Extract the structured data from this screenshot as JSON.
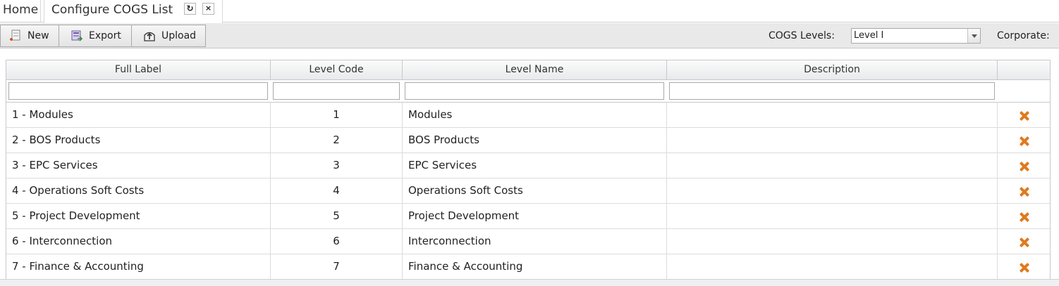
{
  "tabs": {
    "home": "Home",
    "active": "Configure COGS List",
    "refresh_glyph": "↻",
    "close_glyph": "×"
  },
  "toolbar": {
    "new_label": "New",
    "export_label": "Export",
    "upload_label": "Upload",
    "cogs_levels_label": "COGS Levels:",
    "cogs_levels_value": "Level I",
    "corporate_label": "Corporate:"
  },
  "grid": {
    "columns": [
      "Full Label",
      "Level Code",
      "Level Name",
      "Description"
    ],
    "rows": [
      {
        "full_label": "1 - Modules",
        "level_code": "1",
        "level_name": "Modules",
        "description": ""
      },
      {
        "full_label": "2 - BOS Products",
        "level_code": "2",
        "level_name": "BOS Products",
        "description": ""
      },
      {
        "full_label": "3 - EPC Services",
        "level_code": "3",
        "level_name": "EPC Services",
        "description": ""
      },
      {
        "full_label": "4 - Operations Soft Costs",
        "level_code": "4",
        "level_name": "Operations Soft Costs",
        "description": ""
      },
      {
        "full_label": "5 - Project Development",
        "level_code": "5",
        "level_name": "Project Development",
        "description": ""
      },
      {
        "full_label": "6 - Interconnection",
        "level_code": "6",
        "level_name": "Interconnection",
        "description": ""
      },
      {
        "full_label": "7 - Finance & Accounting",
        "level_code": "7",
        "level_name": "Finance & Accounting",
        "description": ""
      }
    ]
  },
  "colors": {
    "delete_icon": "#e07a1e",
    "toolbar_bg": "#e9e9e9",
    "header_bg": "#e9eaec"
  },
  "icons": {
    "new": "new-document-icon",
    "export": "export-icon",
    "upload": "upload-icon",
    "delete": "delete-x-icon"
  }
}
